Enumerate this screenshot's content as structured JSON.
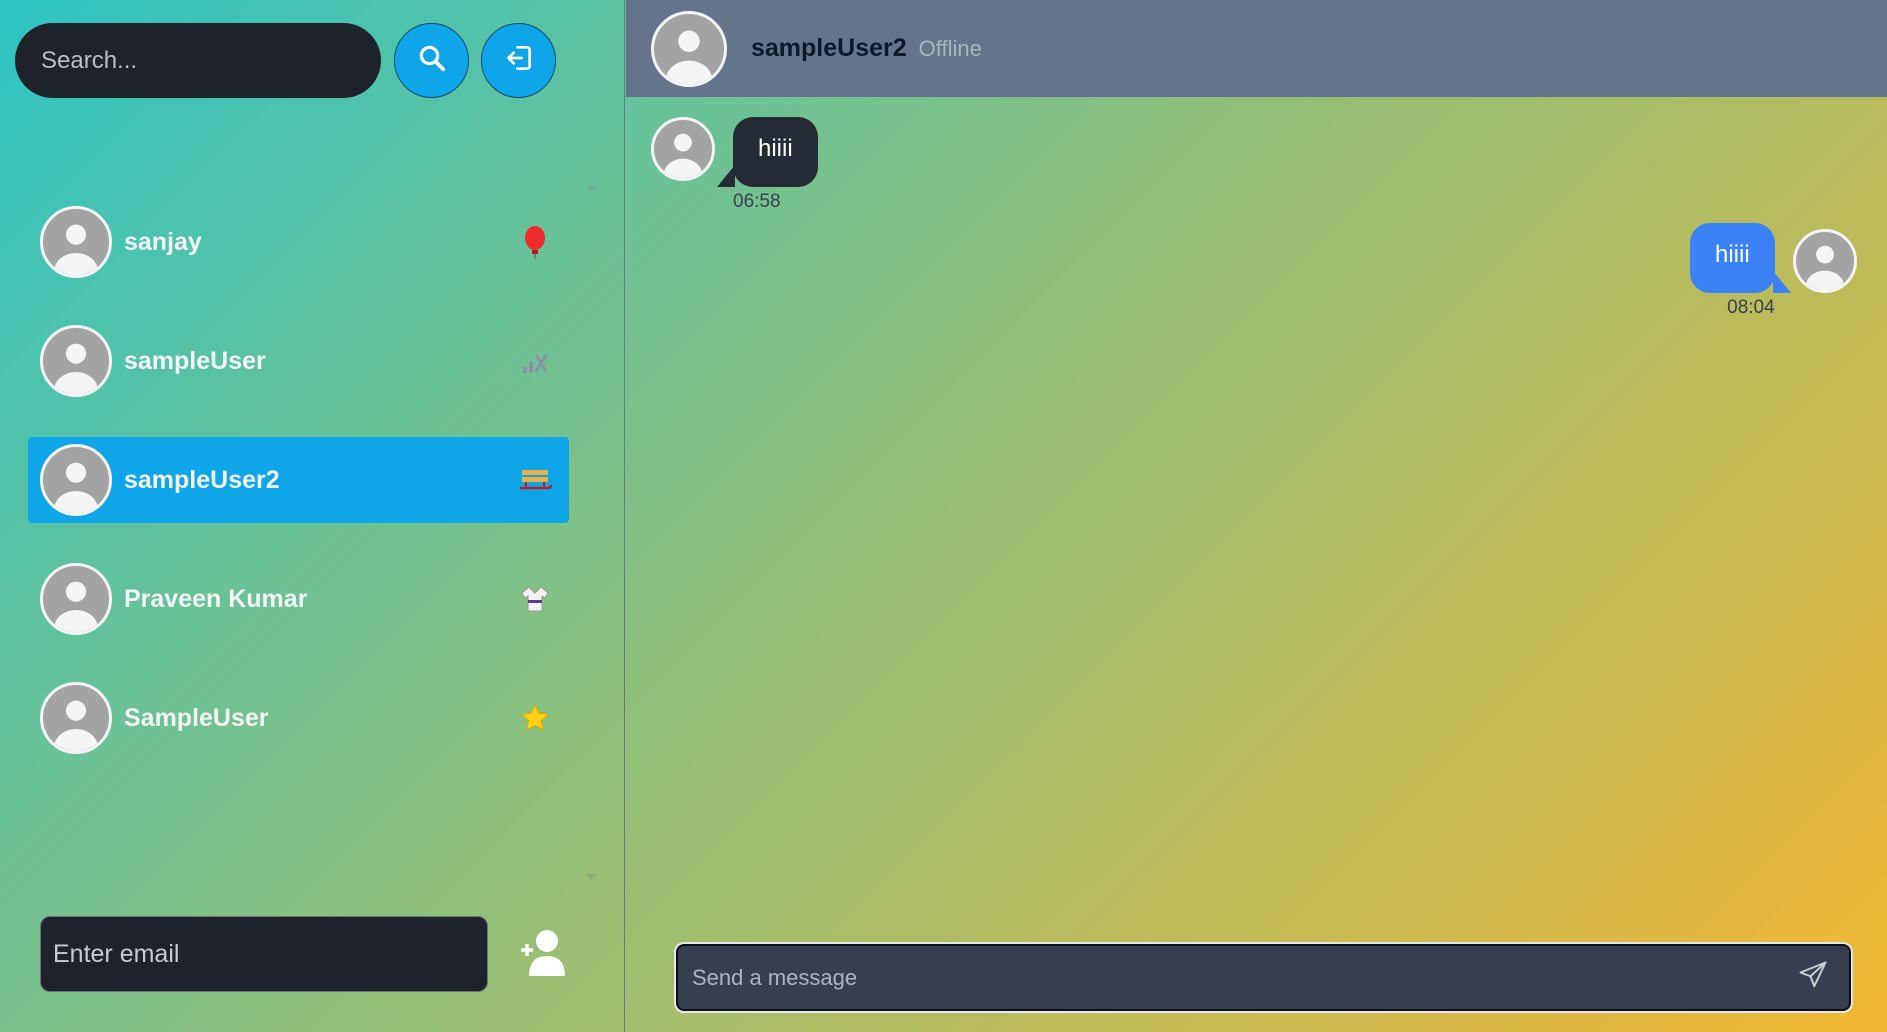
{
  "sidebar": {
    "search": {
      "placeholder": "Search..."
    },
    "buttons": {
      "search_icon": "search-icon",
      "logout_icon": "logout-icon"
    },
    "users": [
      {
        "name": "sanjay",
        "emoji": "red-balloon-icon",
        "active": false
      },
      {
        "name": "sampleUser",
        "emoji": "no-signal-icon",
        "active": false
      },
      {
        "name": "sampleUser2",
        "emoji": "sled-icon",
        "active": true
      },
      {
        "name": "Praveen Kumar",
        "emoji": "martial-arts-uniform-icon",
        "active": false
      },
      {
        "name": "SampleUser",
        "emoji": "star-icon",
        "active": false
      }
    ],
    "add_user": {
      "placeholder": "Enter email",
      "icon": "add-user-icon"
    }
  },
  "chat": {
    "header": {
      "name": "sampleUser2",
      "status": "Offline"
    },
    "messages": [
      {
        "direction": "incoming",
        "text": "hiiii",
        "time": "06:58"
      },
      {
        "direction": "outgoing",
        "text": "hiiii",
        "time": "08:04"
      }
    ],
    "composer": {
      "placeholder": "Send a message",
      "send_icon": "send-icon"
    }
  },
  "colors": {
    "accent": "#0ea5e9",
    "outgoing_bubble": "#3b82f6",
    "incoming_bubble": "#252b35",
    "header_bg": "#64748b"
  }
}
